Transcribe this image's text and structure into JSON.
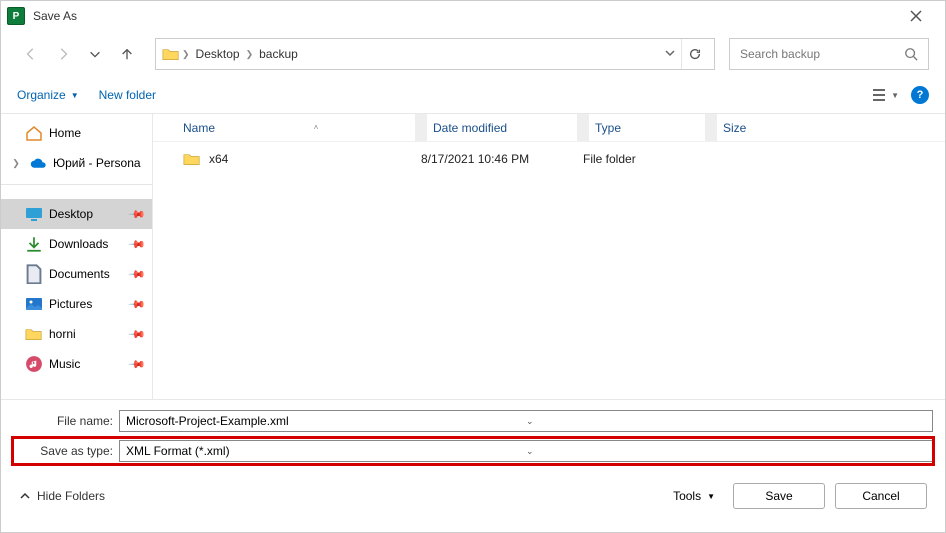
{
  "window": {
    "title": "Save As"
  },
  "nav": {
    "breadcrumbs": [
      "Desktop",
      "backup"
    ],
    "search_placeholder": "Search backup"
  },
  "toolbar": {
    "organize": "Organize",
    "newfolder": "New folder"
  },
  "sidebar": {
    "home": "Home",
    "onedrive": "Юрий - Persona",
    "items": [
      {
        "label": "Desktop",
        "selected": true,
        "icon": "desktop"
      },
      {
        "label": "Downloads",
        "icon": "download"
      },
      {
        "label": "Documents",
        "icon": "document"
      },
      {
        "label": "Pictures",
        "icon": "pictures"
      },
      {
        "label": "horni",
        "icon": "folder"
      },
      {
        "label": "Music",
        "icon": "music"
      }
    ]
  },
  "columns": {
    "name": "Name",
    "date": "Date modified",
    "type": "Type",
    "size": "Size"
  },
  "rows": [
    {
      "name": "x64",
      "date": "8/17/2021 10:46 PM",
      "type": "File folder",
      "size": ""
    }
  ],
  "fields": {
    "filename_label": "File name:",
    "filename_value": "Microsoft-Project-Example.xml",
    "savetype_label": "Save as type:",
    "savetype_value": "XML Format (*.xml)"
  },
  "footer": {
    "hide": "Hide Folders",
    "tools": "Tools",
    "save": "Save",
    "cancel": "Cancel"
  }
}
